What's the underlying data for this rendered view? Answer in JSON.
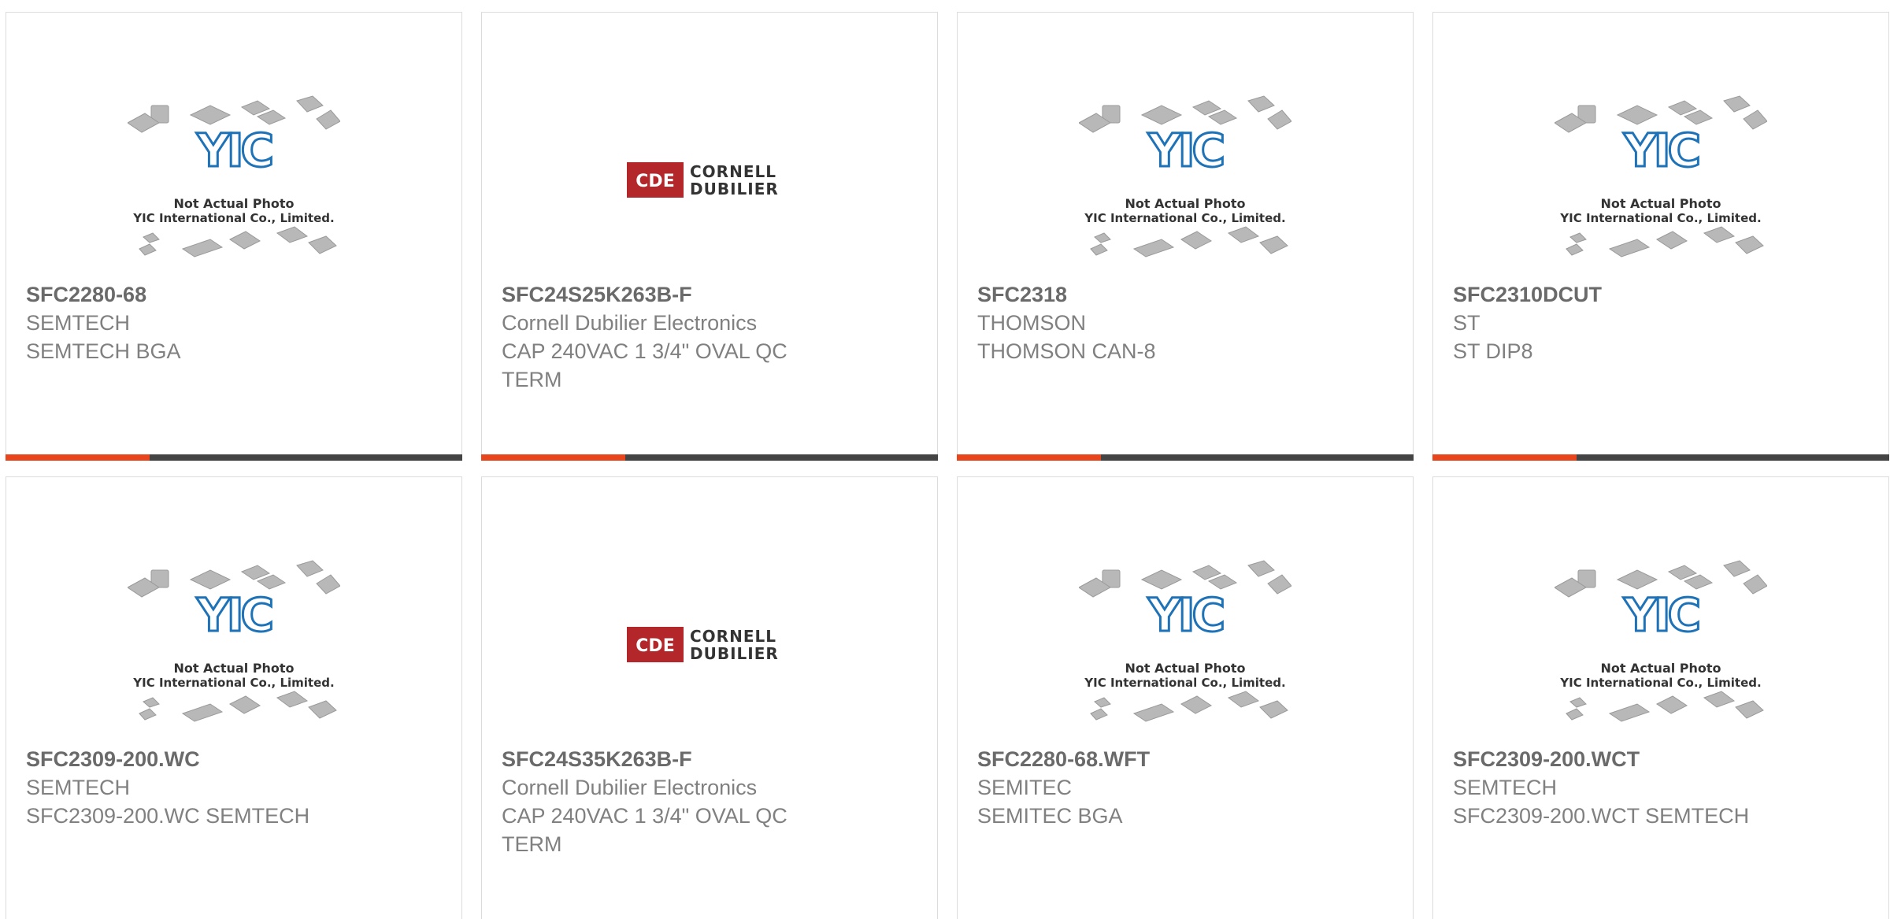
{
  "products": [
    {
      "part_number": "SFC2280-68",
      "manufacturer": "SEMTECH",
      "description": "SEMTECH BGA",
      "image": "yic-placeholder",
      "image_text_1": "Not Actual Photo",
      "image_text_2": "YIC International Co., Limited."
    },
    {
      "part_number": "SFC24S25K263B-F",
      "manufacturer": "Cornell Dubilier Electronics",
      "description": "CAP 240VAC 1 3/4\" OVAL QC TERM",
      "image": "cde-logo",
      "logo_mark": "CDE",
      "logo_name_1": "CORNELL",
      "logo_name_2": "DUBILIER"
    },
    {
      "part_number": "SFC2318",
      "manufacturer": "THOMSON",
      "description": "THOMSON CAN-8",
      "image": "yic-placeholder",
      "image_text_1": "Not Actual Photo",
      "image_text_2": "YIC International Co., Limited."
    },
    {
      "part_number": "SFC2310DCUT",
      "manufacturer": "ST",
      "description": "ST DIP8",
      "image": "yic-placeholder",
      "image_text_1": "Not Actual Photo",
      "image_text_2": "YIC International Co., Limited."
    },
    {
      "part_number": "SFC2309-200.WC",
      "manufacturer": "SEMTECH",
      "description": "SFC2309-200.WC SEMTECH",
      "image": "yic-placeholder",
      "image_text_1": "Not Actual Photo",
      "image_text_2": "YIC International Co., Limited."
    },
    {
      "part_number": "SFC24S35K263B-F",
      "manufacturer": "Cornell Dubilier Electronics",
      "description": "CAP 240VAC 1 3/4\" OVAL QC TERM",
      "image": "cde-logo",
      "logo_mark": "CDE",
      "logo_name_1": "CORNELL",
      "logo_name_2": "DUBILIER"
    },
    {
      "part_number": "SFC2280-68.WFT",
      "manufacturer": "SEMITEC",
      "description": "SEMITEC BGA",
      "image": "yic-placeholder",
      "image_text_1": "Not Actual Photo",
      "image_text_2": "YIC International Co., Limited."
    },
    {
      "part_number": "SFC2309-200.WCT",
      "manufacturer": "SEMTECH",
      "description": "SFC2309-200.WCT SEMTECH",
      "image": "yic-placeholder",
      "image_text_1": "Not Actual Photo",
      "image_text_2": "YIC International Co., Limited."
    }
  ],
  "colors": {
    "accent": "#e8451d",
    "bar": "#444444",
    "yic_blue": "#1e73b8",
    "cde_red": "#b3262a"
  }
}
